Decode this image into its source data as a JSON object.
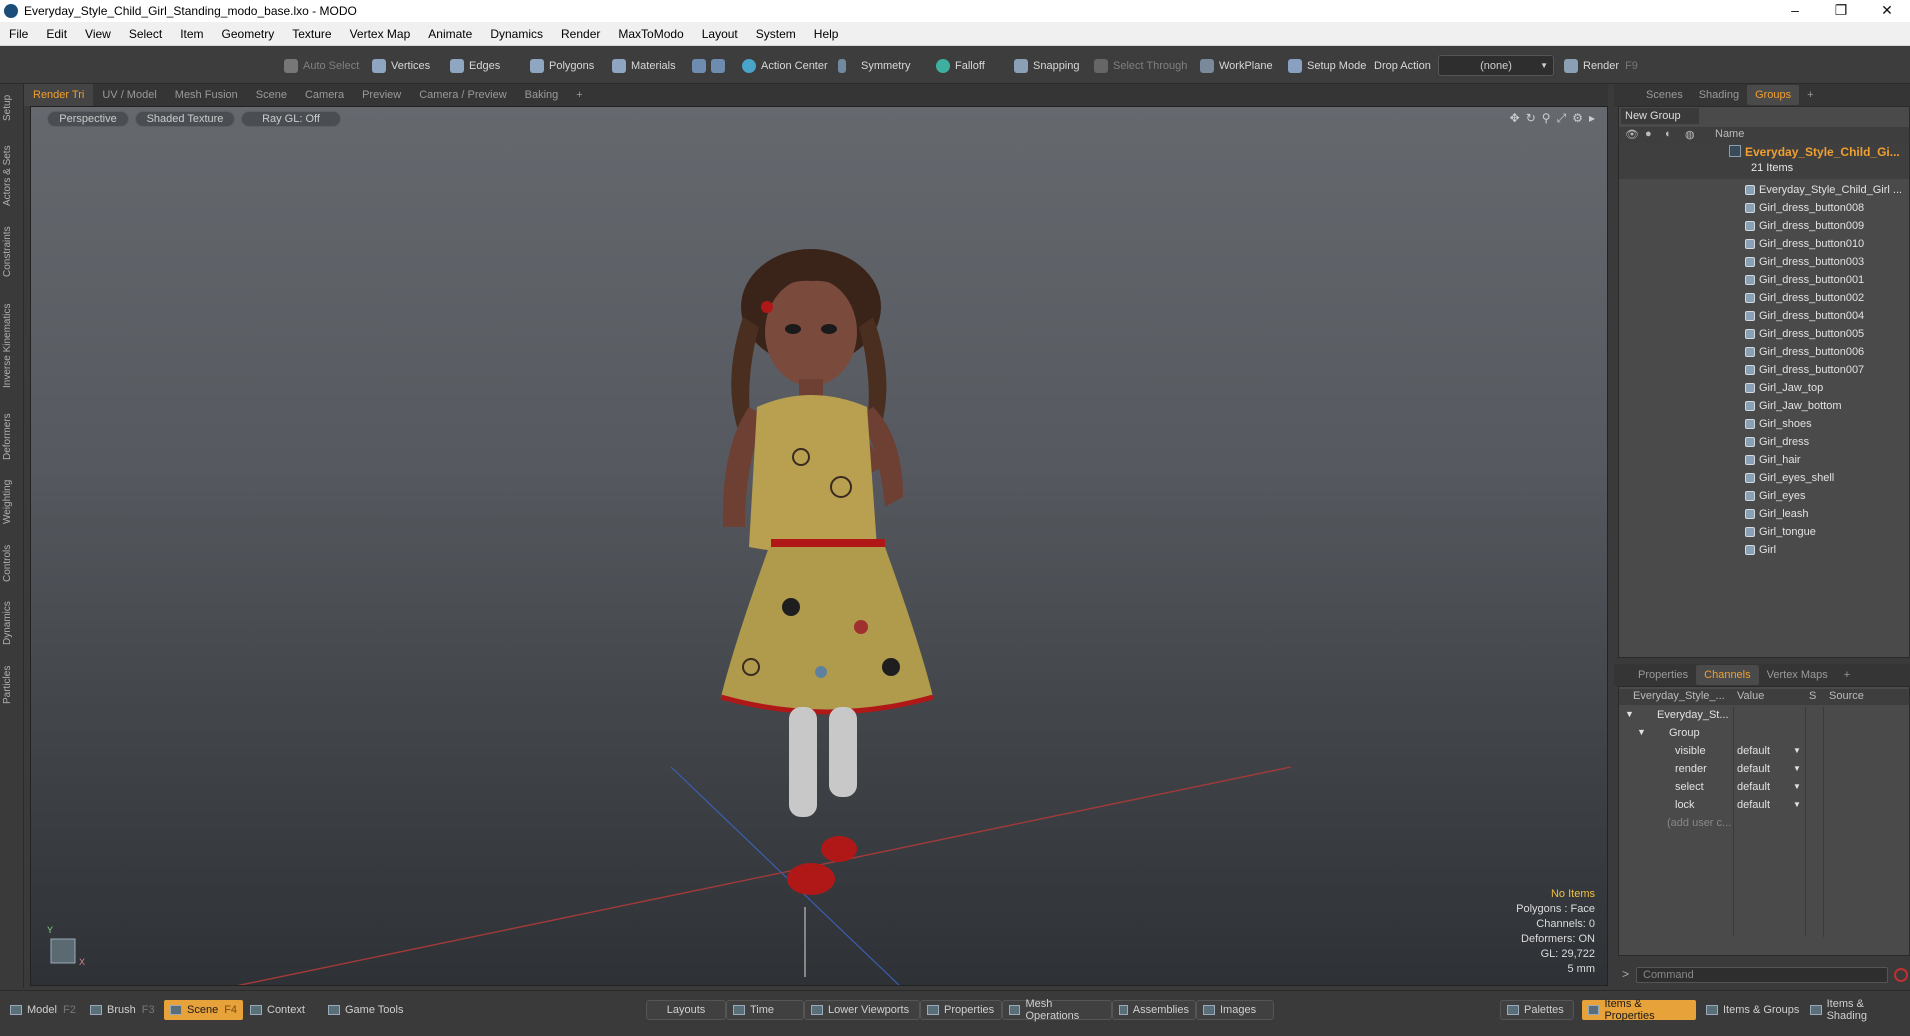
{
  "window": {
    "title": "Everyday_Style_Child_Girl_Standing_modo_base.lxo - MODO",
    "minimize": "–",
    "restore": "❐",
    "close": "✕"
  },
  "menu": [
    "File",
    "Edit",
    "View",
    "Select",
    "Item",
    "Geometry",
    "Texture",
    "Vertex Map",
    "Animate",
    "Dynamics",
    "Render",
    "MaxToModo",
    "Layout",
    "System",
    "Help"
  ],
  "toolbar": {
    "auto_select": "Auto Select",
    "vertices": "Vertices",
    "edges": "Edges",
    "polygons": "Polygons",
    "materials": "Materials",
    "action_center": "Action Center",
    "symmetry": "Symmetry",
    "falloff": "Falloff",
    "snapping": "Snapping",
    "select_through": "Select Through",
    "workplane": "WorkPlane",
    "setup_mode": "Setup Mode",
    "drop_action": "Drop Action",
    "drop_value": "(none)",
    "render": "Render",
    "render_key": "F9"
  },
  "left_tabs": [
    "Setup",
    "Actors & Sets",
    "Constraints",
    "Inverse Kinematics",
    "Deformers",
    "Weighting",
    "Controls",
    "Dynamics",
    "Particles"
  ],
  "viewport_tabs": [
    "Render Tri",
    "UV / Model",
    "Mesh Fusion",
    "Scene",
    "Camera",
    "Preview",
    "Camera / Preview",
    "Baking",
    "+"
  ],
  "viewport": {
    "view_mode": "Perspective",
    "shading": "Shaded Texture",
    "raygl": "Ray GL: Off",
    "stats": {
      "items": "No Items",
      "polygons": "Polygons : Face",
      "channels": "Channels: 0",
      "deformers": "Deformers: ON",
      "gl": "GL: 29,722",
      "scale": "5 mm"
    }
  },
  "right_tabs": [
    "Scenes",
    "Shading",
    "Groups",
    "+"
  ],
  "groups": {
    "new_group": "New Group",
    "name_col": "Name",
    "root_name": "Everyday_Style_Child_Gi...",
    "root_count": "21 Items",
    "items": [
      "Everyday_Style_Child_Girl ...",
      "Girl_dress_button008",
      "Girl_dress_button009",
      "Girl_dress_button010",
      "Girl_dress_button003",
      "Girl_dress_button001",
      "Girl_dress_button002",
      "Girl_dress_button004",
      "Girl_dress_button005",
      "Girl_dress_button006",
      "Girl_dress_button007",
      "Girl_Jaw_top",
      "Girl_Jaw_bottom",
      "Girl_shoes",
      "Girl_dress",
      "Girl_hair",
      "Girl_eyes_shell",
      "Girl_eyes",
      "Girl_leash",
      "Girl_tongue",
      "Girl"
    ]
  },
  "props_tabs": [
    "Properties",
    "Channels",
    "Vertex Maps",
    "+"
  ],
  "channels": {
    "col_name": "Everyday_Style_...",
    "col_value": "Value",
    "col_s": "S",
    "col_source": "Source",
    "root": "Everyday_St...",
    "group": "Group",
    "rows": [
      {
        "name": "visible",
        "value": "default"
      },
      {
        "name": "render",
        "value": "default"
      },
      {
        "name": "select",
        "value": "default"
      },
      {
        "name": "lock",
        "value": "default"
      }
    ],
    "add_user": "(add user c..."
  },
  "command": {
    "placeholder": "Command"
  },
  "bottom": {
    "model": "Model",
    "model_key": "F2",
    "brush": "Brush",
    "brush_key": "F3",
    "scene": "Scene",
    "scene_key": "F4",
    "context": "Context",
    "game_tools": "Game Tools",
    "layouts": "Layouts",
    "time": "Time",
    "lower_viewports": "Lower Viewports",
    "properties": "Properties",
    "mesh_operations": "Mesh Operations",
    "assemblies": "Assemblies",
    "images": "Images",
    "palettes": "Palettes",
    "items_properties": "Items & Properties",
    "items_groups": "Items & Groups",
    "items_shading": "Items & Shading"
  },
  "colors": {
    "accent": "#f0a030",
    "dress": "#b8a050",
    "shoes": "#b01818",
    "background": "#3a3a3a"
  }
}
